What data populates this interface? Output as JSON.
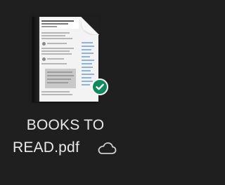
{
  "file": {
    "name_line1": "BOOKS TO",
    "name_line2": "READ.pdf",
    "status_icon": "checkmark-icon",
    "sync_icon": "cloud-icon",
    "status_color": "#0f8a5f"
  },
  "thumbnail": {
    "type": "pdf-document",
    "accent": "#8fb3d9"
  }
}
